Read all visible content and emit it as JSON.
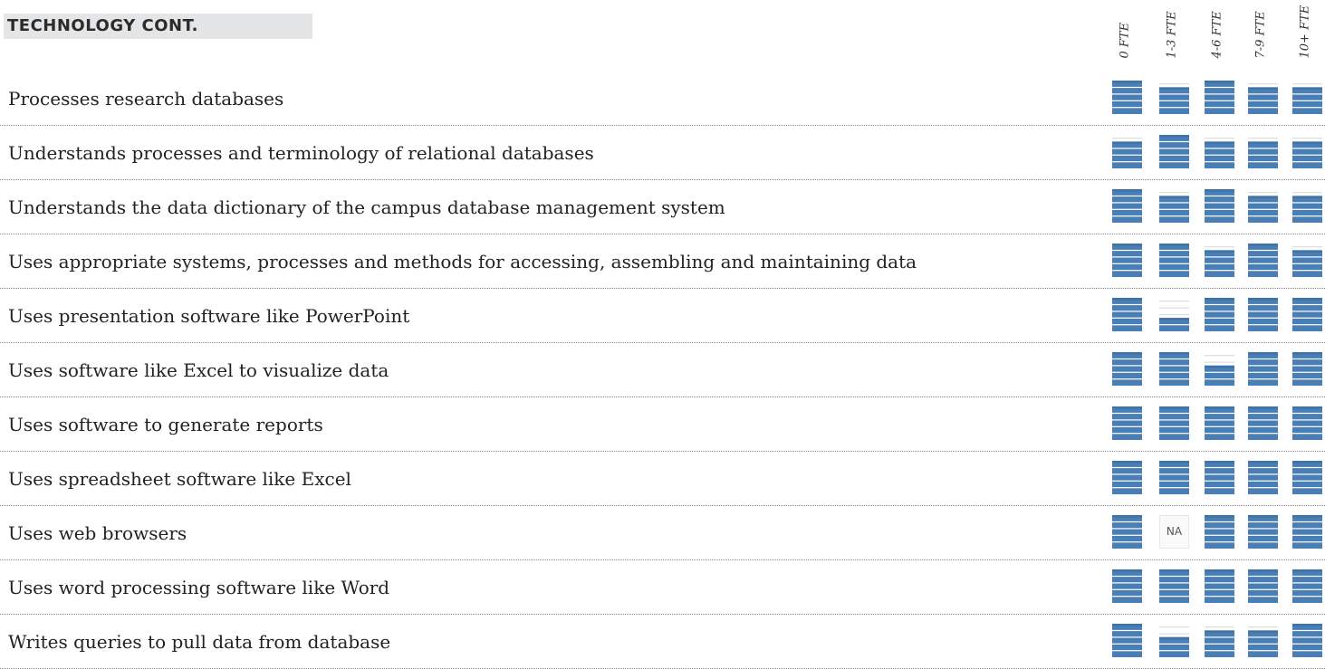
{
  "section_title": "TECHNOLOGY CONT.",
  "colors": {
    "bar": "#4a7fb5",
    "bar_dark": "#3f72a6",
    "empty_line": "#d3d6da",
    "rule": "#8a8a8a"
  },
  "chart_data": {
    "type": "table",
    "title": "TECHNOLOGY CONT.",
    "columns": [
      "0 FTE",
      "1-3 FTE",
      "4-6 FTE",
      "7-9 FTE",
      "10+ FTE"
    ],
    "scale_max": 5,
    "rows": [
      {
        "label": "Processes research databases",
        "levels": [
          5,
          4,
          5,
          4,
          4
        ]
      },
      {
        "label": "Understands processes and terminology of relational databases",
        "levels": [
          4,
          5,
          4,
          4,
          4
        ]
      },
      {
        "label": "Understands the data dictionary of the campus database management system",
        "levels": [
          5,
          4,
          5,
          4,
          4
        ]
      },
      {
        "label": "Uses appropriate systems, processes and methods for accessing, assembling and maintaining data",
        "levels": [
          5,
          5,
          4,
          5,
          4
        ]
      },
      {
        "label": "Uses presentation software like PowerPoint",
        "levels": [
          5,
          2,
          5,
          5,
          5
        ]
      },
      {
        "label": "Uses software like Excel to visualize data",
        "levels": [
          5,
          5,
          3,
          5,
          5
        ]
      },
      {
        "label": "Uses software to generate reports",
        "levels": [
          5,
          5,
          5,
          5,
          5
        ]
      },
      {
        "label": "Uses spreadsheet software like Excel",
        "levels": [
          5,
          5,
          5,
          5,
          5
        ]
      },
      {
        "label": "Uses web browsers",
        "levels": [
          5,
          "NA",
          5,
          5,
          5
        ]
      },
      {
        "label": "Uses word processing software like Word",
        "levels": [
          5,
          5,
          5,
          5,
          5
        ]
      },
      {
        "label": "Writes queries to pull data from database",
        "levels": [
          5,
          3,
          4,
          4,
          5
        ]
      }
    ]
  }
}
